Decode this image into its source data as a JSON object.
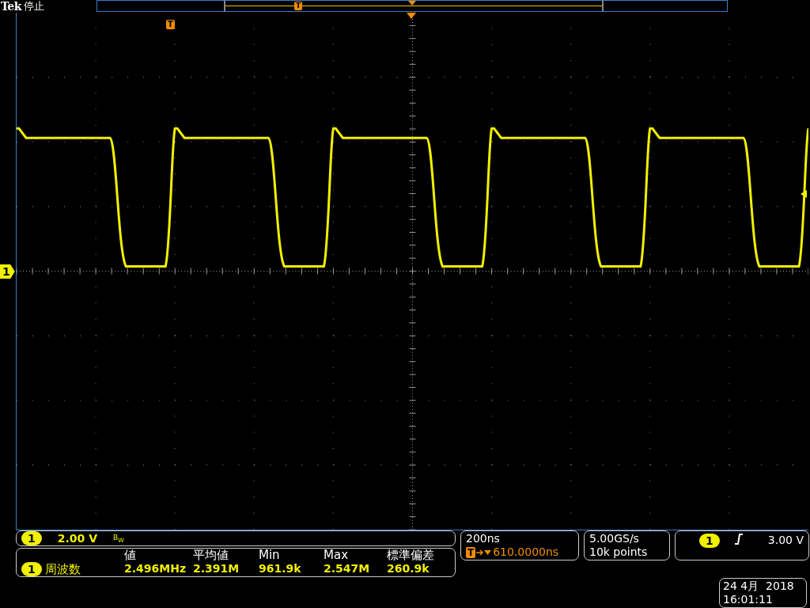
{
  "status": {
    "brand": "Tek",
    "state": "停止"
  },
  "record_bar": {
    "trigger_marker": "T"
  },
  "graticule": {
    "trigger_marker": "T",
    "channel_marker": "1"
  },
  "channel": {
    "number": "1",
    "scale": "2.00 V",
    "bandwidth": "B$_{W}$"
  },
  "measurements": {
    "headers": [
      "値",
      "平均値",
      "Min",
      "Max",
      "標準偏差"
    ],
    "rows": [
      {
        "channel": "1",
        "name": "周波数",
        "values": [
          "2.496MHz",
          "2.391M",
          "961.9k",
          "2.547M",
          "260.9k"
        ]
      }
    ]
  },
  "timebase": {
    "scale": "200ns",
    "trigger_badge": "T",
    "delay": "610.0000ns"
  },
  "acquisition": {
    "sample_rate": "5.00GS/s",
    "record_length": "10k points"
  },
  "trigger": {
    "source": "1",
    "slope_rising": true,
    "level": "3.00 V"
  },
  "clock": {
    "date": "24 4月  2018",
    "time": "16:01:11"
  }
}
